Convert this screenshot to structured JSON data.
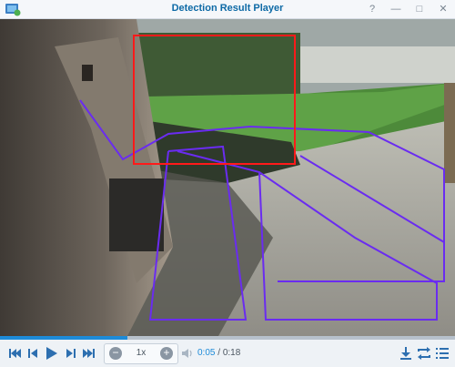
{
  "window": {
    "title": "Detection Result Player",
    "help_label": "?",
    "minimize_label": "—",
    "maximize_label": "□",
    "close_label": "✕"
  },
  "player": {
    "speed": "1x",
    "speed_minus": "−",
    "speed_plus": "+",
    "current_time": "0:05",
    "separator": " / ",
    "total_time": "0:18",
    "progress": 0.28
  },
  "colors": {
    "accent": "#1d8bd9",
    "detection_box": "#ff1a1a",
    "zone_outline": "#6a2cf0"
  },
  "icons": [
    "app-icon",
    "skip-start-icon",
    "step-back-icon",
    "play-icon",
    "step-forward-icon",
    "skip-end-icon",
    "volume-icon",
    "download-icon",
    "repeat-icon",
    "list-icon"
  ]
}
